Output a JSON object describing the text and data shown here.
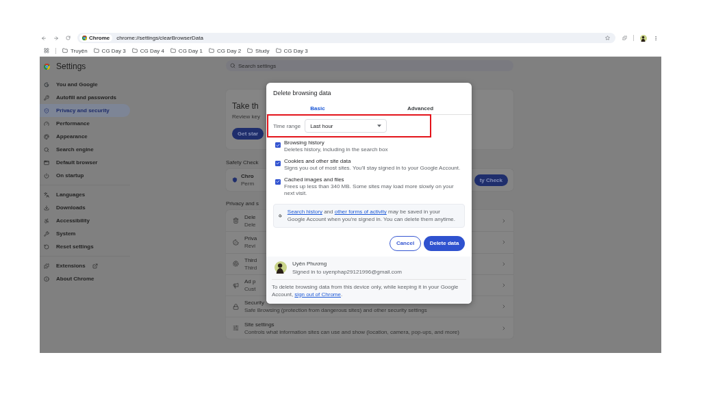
{
  "browser": {
    "omnibox": {
      "chip": "Chrome",
      "url": "chrome://settings/clearBrowserData"
    },
    "bookmarks": [
      "Truyện",
      "CG Day 3",
      "CG Day 4",
      "CG Day 1",
      "CG Day 2",
      "Study",
      "CG Day 3"
    ]
  },
  "settings": {
    "title": "Settings",
    "search": {
      "placeholder": "Search settings"
    },
    "sidebar": {
      "groups": [
        [
          {
            "label": "You and Google",
            "selected": false
          },
          {
            "label": "Autofill and passwords",
            "selected": false
          },
          {
            "label": "Privacy and security",
            "selected": true
          },
          {
            "label": "Performance",
            "selected": false
          },
          {
            "label": "Appearance",
            "selected": false
          },
          {
            "label": "Search engine",
            "selected": false
          },
          {
            "label": "Default browser",
            "selected": false
          },
          {
            "label": "On startup",
            "selected": false
          }
        ],
        [
          {
            "label": "Languages",
            "selected": false
          },
          {
            "label": "Downloads",
            "selected": false
          },
          {
            "label": "Accessibility",
            "selected": false
          },
          {
            "label": "System",
            "selected": false
          },
          {
            "label": "Reset settings",
            "selected": false
          }
        ],
        [
          {
            "label": "Extensions",
            "selected": false
          },
          {
            "label": "About Chrome",
            "selected": false
          }
        ]
      ]
    },
    "privacy_guide": {
      "title": "Take th",
      "text": "Review key",
      "button": "Get star"
    },
    "safety_check": {
      "heading": "Safety Check",
      "title": "Chro",
      "text": "Perm",
      "button": "ty Check"
    },
    "privacy_section": {
      "heading": "Privacy and s",
      "rows": [
        {
          "title": "Dele",
          "text": "Dele"
        },
        {
          "title": "Priva",
          "text": "Revi"
        },
        {
          "title": "Third",
          "text": "Third"
        },
        {
          "title": "Ad p",
          "text": "Cust"
        },
        {
          "title": "Security",
          "text": "Safe Browsing (protection from dangerous sites) and other security settings"
        },
        {
          "title": "Site settings",
          "text": "Controls what information sites can use and show (location, camera, pop-ups, and more)"
        }
      ]
    }
  },
  "dialog": {
    "title": "Delete browsing data",
    "tabs": [
      {
        "label": "Basic",
        "selected": true
      },
      {
        "label": "Advanced",
        "selected": false
      }
    ],
    "time_range": {
      "label": "Time range",
      "value": "Last hour"
    },
    "options": [
      {
        "title": "Browsing history",
        "text": "Deletes history, including in the search box",
        "checked": true
      },
      {
        "title": "Cookies and other site data",
        "text": "Signs you out of most sites. You'll stay signed in to your Google Account.",
        "checked": true
      },
      {
        "title": "Cached images and files",
        "text": "Frees up less than 340 MB. Some sites may load more slowly on your next visit.",
        "checked": true
      }
    ],
    "info": [
      {
        "kind": "link",
        "text": "Search history"
      },
      {
        "kind": "text",
        "text": " and "
      },
      {
        "kind": "link",
        "text": "other forms of activity"
      },
      {
        "kind": "text",
        "text": " may be saved in your Google Account when you're signed in. You can delete them anytime."
      }
    ],
    "buttons": {
      "cancel": "Cancel",
      "confirm": "Delete data"
    },
    "account": {
      "name": "Uyên Phương",
      "email": "Signed in to uyenphap29121996@gmail.com"
    },
    "footer": [
      {
        "kind": "text",
        "text": "To delete browsing data from this device only, while keeping it in your Google Account, "
      },
      {
        "kind": "link",
        "text": "sign out of Chrome"
      },
      {
        "kind": "text",
        "text": "."
      }
    ]
  }
}
